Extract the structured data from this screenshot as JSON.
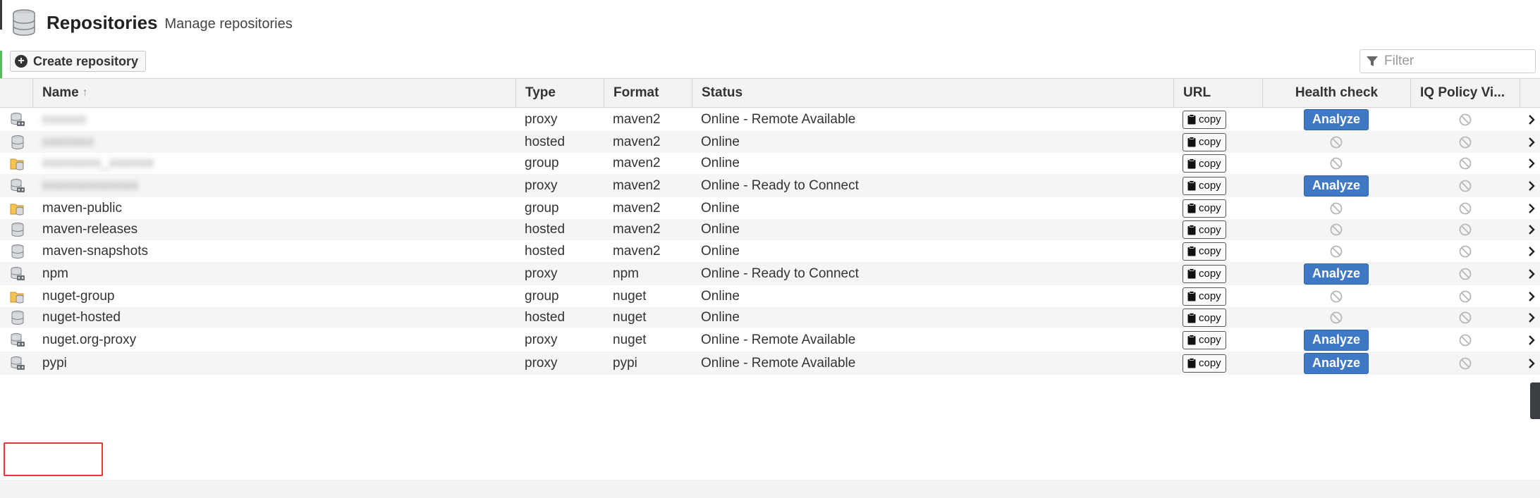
{
  "header": {
    "title": "Repositories",
    "subtitle": "Manage repositories",
    "icon": "database-icon"
  },
  "toolbar": {
    "create_label": "Create repository",
    "filter_placeholder": "Filter"
  },
  "columns": {
    "name": "Name",
    "type": "Type",
    "format": "Format",
    "status": "Status",
    "url": "URL",
    "health": "Health check",
    "iq": "IQ Policy Vi..."
  },
  "copy_label": "copy",
  "analyze_label": "Analyze",
  "rows": [
    {
      "name": "xxxxxx",
      "blurred": true,
      "type": "proxy",
      "format": "maven2",
      "status": "Online - Remote Available",
      "icon": "proxy",
      "health": "analyze"
    },
    {
      "name": "xxxxxxx",
      "blurred": true,
      "type": "hosted",
      "format": "maven2",
      "status": "Online",
      "icon": "hosted",
      "health": "na"
    },
    {
      "name": "xxxxxxxx_xxxxxx",
      "blurred": true,
      "type": "group",
      "format": "maven2",
      "status": "Online",
      "icon": "group",
      "health": "na"
    },
    {
      "name": "xxxxxxxxxxxxx",
      "blurred": true,
      "type": "proxy",
      "format": "maven2",
      "status": "Online - Ready to Connect",
      "icon": "proxy",
      "health": "analyze"
    },
    {
      "name": "maven-public",
      "blurred": false,
      "type": "group",
      "format": "maven2",
      "status": "Online",
      "icon": "group",
      "health": "na"
    },
    {
      "name": "maven-releases",
      "blurred": false,
      "type": "hosted",
      "format": "maven2",
      "status": "Online",
      "icon": "hosted",
      "health": "na"
    },
    {
      "name": "maven-snapshots",
      "blurred": false,
      "type": "hosted",
      "format": "maven2",
      "status": "Online",
      "icon": "hosted",
      "health": "na"
    },
    {
      "name": "npm",
      "blurred": false,
      "type": "proxy",
      "format": "npm",
      "status": "Online - Ready to Connect",
      "icon": "proxy",
      "health": "analyze"
    },
    {
      "name": "nuget-group",
      "blurred": false,
      "type": "group",
      "format": "nuget",
      "status": "Online",
      "icon": "group",
      "health": "na"
    },
    {
      "name": "nuget-hosted",
      "blurred": false,
      "type": "hosted",
      "format": "nuget",
      "status": "Online",
      "icon": "hosted",
      "health": "na"
    },
    {
      "name": "nuget.org-proxy",
      "blurred": false,
      "type": "proxy",
      "format": "nuget",
      "status": "Online - Remote Available",
      "icon": "proxy",
      "health": "analyze"
    },
    {
      "name": "pypi",
      "blurred": false,
      "type": "proxy",
      "format": "pypi",
      "status": "Online - Remote Available",
      "icon": "proxy",
      "health": "analyze"
    }
  ],
  "colors": {
    "analyze": "#3f78c4",
    "highlight": "#e53935",
    "header_bg": "#f3f3f3",
    "alt_row": "#f5f5f5"
  }
}
